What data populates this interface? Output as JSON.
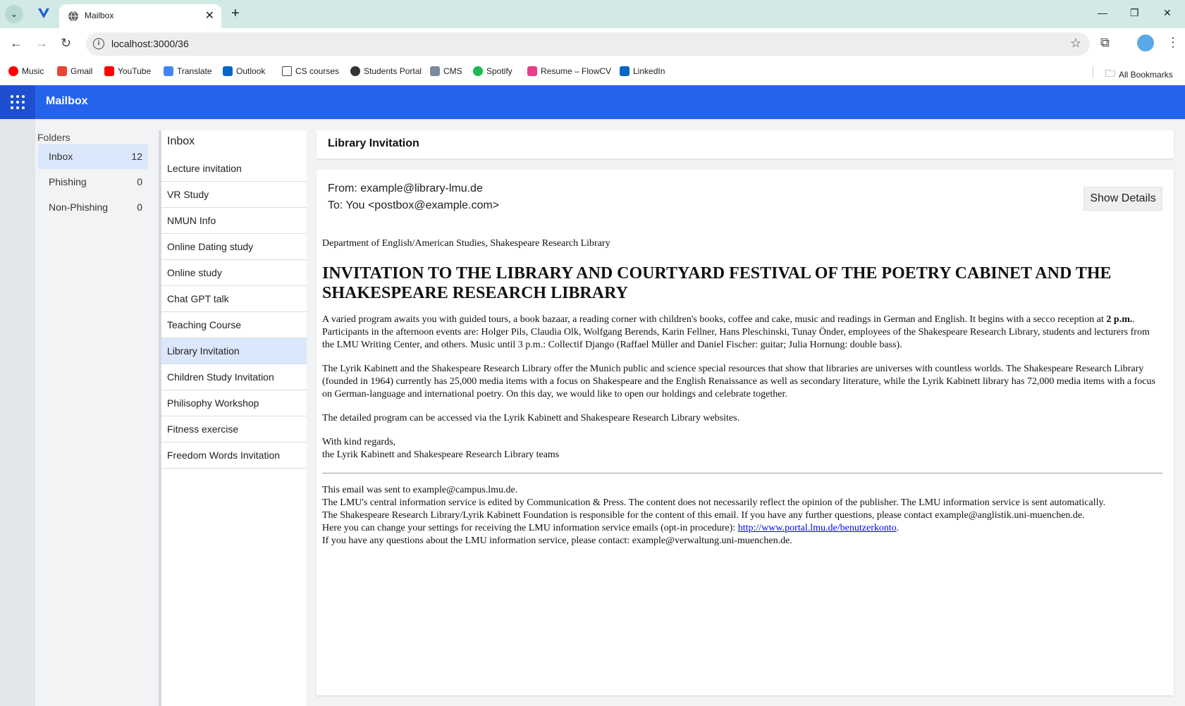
{
  "browser": {
    "tab_title": "Mailbox",
    "url": "localhost:3000/36",
    "bookmarks": [
      {
        "label": "Music",
        "icon": "youtube-music-icon",
        "color": "#ff0000"
      },
      {
        "label": "Gmail",
        "icon": "gmail-icon",
        "color": "#ea4335"
      },
      {
        "label": "YouTube",
        "icon": "youtube-icon",
        "color": "#ff0000"
      },
      {
        "label": "Translate",
        "icon": "translate-icon",
        "color": "#4285f4"
      },
      {
        "label": "Outlook",
        "icon": "outlook-icon",
        "color": "#0a64c7"
      },
      {
        "label": "CS courses",
        "icon": "folder-icon",
        "color": "#444444"
      },
      {
        "label": "Students Portal",
        "icon": "portal-icon",
        "color": "#333333"
      },
      {
        "label": "CMS",
        "icon": "cms-icon",
        "color": "#7a8aa0"
      },
      {
        "label": "Spotify",
        "icon": "spotify-icon",
        "color": "#1db954"
      },
      {
        "label": "Resume – FlowCV",
        "icon": "flowcv-icon",
        "color": "#e83e8c"
      },
      {
        "label": "LinkedIn",
        "icon": "linkedin-icon",
        "color": "#0a66c2"
      }
    ],
    "all_bookmarks": "All Bookmarks"
  },
  "app": {
    "title": "Mailbox"
  },
  "folders": {
    "title": "Folders",
    "items": [
      {
        "name": "Inbox",
        "count": "12"
      },
      {
        "name": "Phishing",
        "count": "0"
      },
      {
        "name": "Non-Phishing",
        "count": "0"
      }
    ]
  },
  "inbox": {
    "title": "Inbox",
    "messages": [
      "Lecture invitation",
      "VR Study",
      "NMUN Info",
      "Online Dating study",
      "Online study",
      "Chat GPT talk",
      "Teaching Course",
      "Library Invitation",
      "Children Study Invitation",
      "Philisophy Workshop",
      "Fitness exercise",
      "Freedom Words Invitation"
    ]
  },
  "email": {
    "subject": "Library Invitation",
    "from": "From: example@library-lmu.de",
    "to": "To: You <postbox@example.com>",
    "show_details": "Show Details",
    "department": "Department of English/American Studies, Shakespeare Research Library",
    "heading": "INVITATION TO THE LIBRARY AND COURTYARD FESTIVAL OF THE POETRY CABINET AND THE SHAKESPEARE RESEARCH LIBRARY",
    "p1_a": "A varied program awaits you with guided tours, a book bazaar, a reading corner with children's books, coffee and cake, music and readings in German and English. It begins with a secco reception at ",
    "p1_bold": "2 p.m.",
    "p1_b": ". Participants in the afternoon events are: Holger Pils, Claudia Olk, Wolfgang Berends, Karin Fellner, Hans Pleschinski, Tunay Önder, employees of the Shakespeare Research Library, students and lecturers from the LMU Writing Center, and others. Music until 3 p.m.: Collectif Django (Raffael Müller and Daniel Fischer: guitar; Julia Hornung: double bass).",
    "p2": "The Lyrik Kabinett and the Shakespeare Research Library offer the Munich public and science special resources that show that libraries are universes with countless worlds. The Shakespeare Research Library (founded in 1964) currently has 25,000 media items with a focus on Shakespeare and the English Renaissance as well as secondary literature, while the Lyrik Kabinett library has 72,000 media items with a focus on German-language and international poetry. On this day, we would like to open our holdings and celebrate together.",
    "p3": "The detailed program can be accessed via the Lyrik Kabinett and Shakespeare Research Library websites.",
    "regards": "With kind regards,",
    "signature": "the Lyrik Kabinett and Shakespeare Research Library teams",
    "footer1": "This email was sent to example@campus.lmu.de.",
    "footer2": "The LMU's central information service is edited by Communication & Press. The content does not necessarily reflect the opinion of the publisher. The LMU information service is sent automatically.",
    "footer3": "The Shakespeare Research Library/Lyrik Kabinett Foundation is responsible for the content of this email. If you have any further questions, please contact example@anglistik.uni-muenchen.de.",
    "footer4_a": "Here you can change your settings for receiving the LMU information service emails (opt-in procedure): ",
    "footer4_link": "http://www.portal.lmu.de/benutzerkonto",
    "footer4_b": ".",
    "footer5": "If you have any questions about the LMU information service, please contact: example@verwaltung.uni-muenchen.de."
  }
}
